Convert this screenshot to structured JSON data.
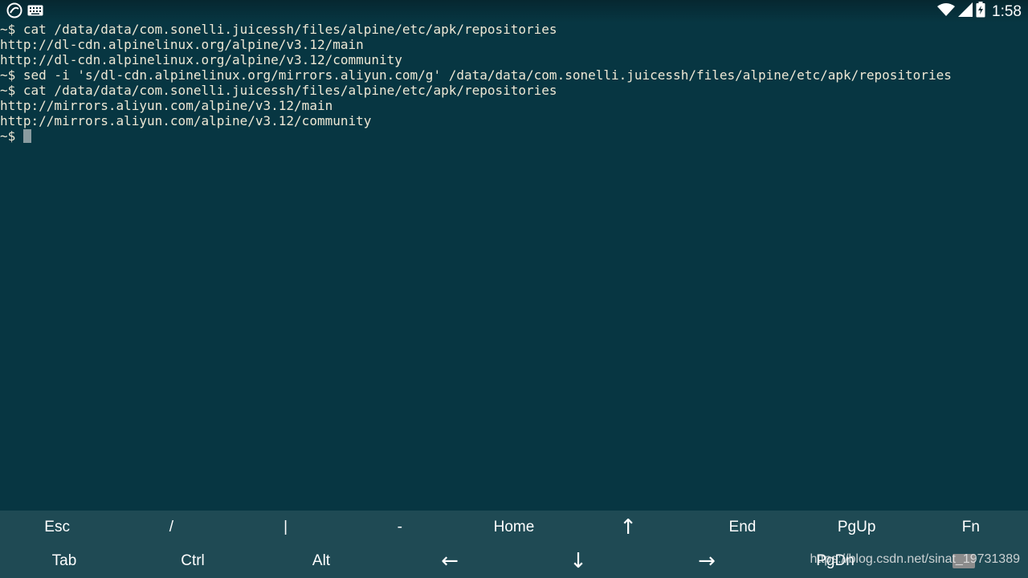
{
  "status_bar": {
    "time": "1:58",
    "icons": [
      "juicessh-app-icon",
      "keyboard-icon",
      "wifi-icon",
      "signal-icon",
      "battery-charging-icon"
    ]
  },
  "terminal": {
    "lines": [
      "~$ cat /data/data/com.sonelli.juicessh/files/alpine/etc/apk/repositories",
      "http://dl-cdn.alpinelinux.org/alpine/v3.12/main",
      "http://dl-cdn.alpinelinux.org/alpine/v3.12/community",
      "~$ sed -i 's/dl-cdn.alpinelinux.org/mirrors.aliyun.com/g' /data/data/com.sonelli.juicessh/files/alpine/etc/apk/repositories",
      "~$ cat /data/data/com.sonelli.juicessh/files/alpine/etc/apk/repositories",
      "http://mirrors.aliyun.com/alpine/v3.12/main",
      "http://mirrors.aliyun.com/alpine/v3.12/community"
    ],
    "prompt": "~$ "
  },
  "extra_keys": {
    "row1": [
      "Esc",
      "/",
      "|",
      "-",
      "Home",
      "↑",
      "End",
      "PgUp",
      "Fn"
    ],
    "row2": [
      "Tab",
      "Ctrl",
      "Alt",
      "←",
      "↓",
      "→",
      "PgDn"
    ]
  },
  "watermark": "https://blog.csdn.net/sinat_19731389"
}
